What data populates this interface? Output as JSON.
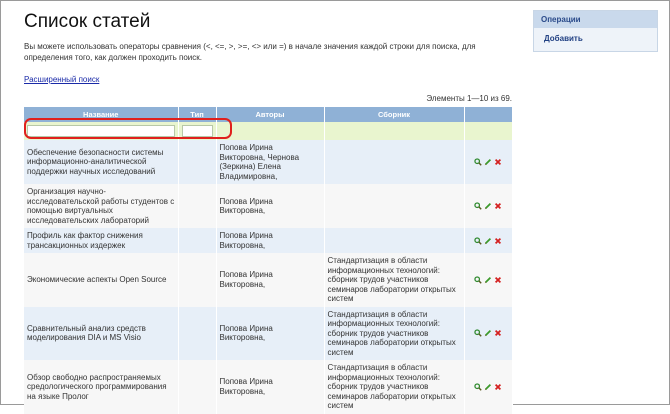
{
  "page": {
    "title": "Список статей",
    "hint": "Вы можете использовать операторы сравнения (<, <=, >, >=, <> или =) в начале значения каждой строки для поиска, для определения того, как должен проходить поиск.",
    "advanced_search": "Расширенный поиск",
    "summary": "Элементы 1—10 из 69."
  },
  "table": {
    "columns": [
      "Название",
      "Тип",
      "Авторы",
      "Сборник"
    ],
    "rows": [
      {
        "title": "Обеспечение безопасности системы информационно-аналитической поддержки научных исследований",
        "type": "",
        "authors": "Попова Ирина Викторовна, Чернова (Зеркина) Елена Владимировна,",
        "collection": ""
      },
      {
        "title": "Организация научно-исследовательской работы студентов с помощью виртуальных исследовательских лабораторий",
        "type": "",
        "authors": "Попова Ирина Викторовна,",
        "collection": ""
      },
      {
        "title": "Профиль как фактор снижения трансакционных издержек",
        "type": "",
        "authors": "Попова Ирина Викторовна,",
        "collection": ""
      },
      {
        "title": "Экономические аспекты Open Source",
        "type": "",
        "authors": "Попова Ирина Викторовна,",
        "collection": "Стандартизация в области информационных технологий: сборник трудов участников семинаров лаборатории открытых систем"
      },
      {
        "title": "Сравнительный анализ средств моделирования DIA и MS Visio",
        "type": "",
        "authors": "Попова Ирина Викторовна,",
        "collection": "Стандартизация в области информационных технологий: сборник трудов участников семинаров лаборатории открытых систем"
      },
      {
        "title": "Обзор свободно распространяемых средологического программирования на языке Пролог",
        "type": "",
        "authors": "Попова Ирина Викторовна,",
        "collection": "Стандартизация в области информационных технологий: сборник трудов участников семинаров лаборатории открытых систем"
      }
    ]
  },
  "sidebar": {
    "header": "Операции",
    "items": [
      "Добавить"
    ]
  },
  "icons": {
    "view": "magnifier-icon",
    "edit": "pencil-icon",
    "delete": "red-x-icon"
  },
  "colors": {
    "header": "#8fb1d6",
    "filter_row": "#e9f5cf",
    "highlight": "#e0201c",
    "link": "#1a2aa8"
  }
}
